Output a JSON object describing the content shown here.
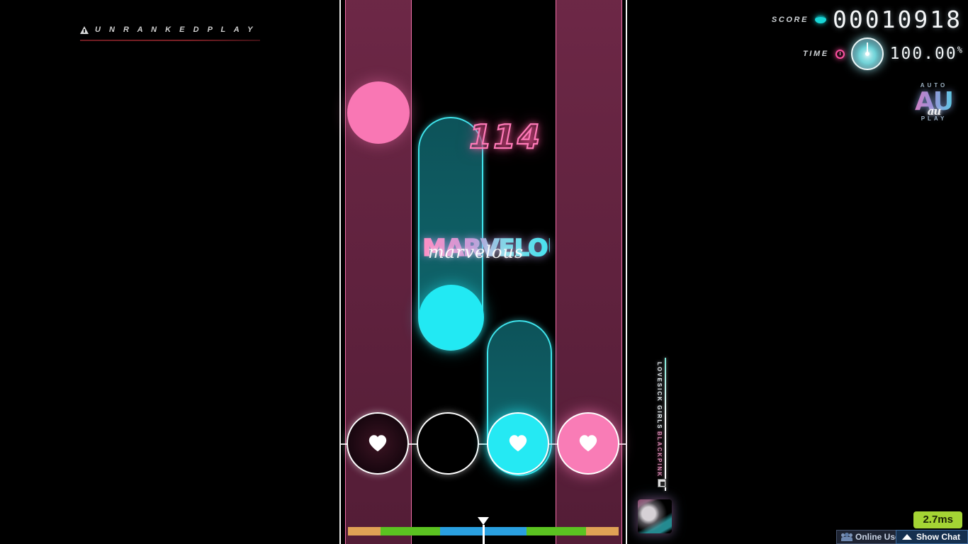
{
  "banner": {
    "icon": "warning-triangle-icon",
    "label": "UNRANKEDPLAY"
  },
  "hud": {
    "score_label": "SCORE",
    "score_icon": "coin-icon",
    "score_value": "00010918",
    "time_label": "TIME",
    "time_icon": "clock-icon",
    "accuracy_value": "100.00",
    "accuracy_symbol": "%"
  },
  "autoplay": {
    "top_label": "AUTO",
    "mark": "AU",
    "script": "au",
    "bottom_label": "PLAY"
  },
  "gameplay": {
    "combo": "114",
    "judgement": "MARVELOUS",
    "judgement_script": "marvelous",
    "lane_count": 4,
    "receptors": [
      {
        "name": "receptor-lane-1",
        "state": "dark",
        "icon": "heart-icon"
      },
      {
        "name": "receptor-lane-2",
        "state": "empty",
        "icon": "none"
      },
      {
        "name": "receptor-lane-3",
        "state": "cyan-active",
        "icon": "heart-icon"
      },
      {
        "name": "receptor-lane-4",
        "state": "pink-active",
        "icon": "heart-icon"
      }
    ]
  },
  "song": {
    "title": "LOVESICK GIRLS",
    "artist": "BLACKPINK",
    "album_art": "album-art-thumbnail"
  },
  "progress": {
    "marker_percent": 50,
    "segments": [
      {
        "color": "#e0a255",
        "width": 12
      },
      {
        "color": "#5bc221",
        "width": 22
      },
      {
        "color": "#2aa0e0",
        "width": 16
      },
      {
        "color": "#2aa0e0",
        "width": 16
      },
      {
        "color": "#5bc221",
        "width": 22
      },
      {
        "color": "#e0a255",
        "width": 12
      }
    ]
  },
  "chrome": {
    "latency_badge": "2.7ms",
    "online_users_label": "Online Users",
    "online_users_icon": "people-icon",
    "show_chat_label": "Show Chat",
    "show_chat_icon": "chevron-up-icon"
  },
  "colors": {
    "cyan": "#22e9f3",
    "pink": "#f977b4",
    "lane_pink_bg": "#a03768",
    "badge_green": "#a4d434",
    "chat_blue": "#15304f"
  }
}
